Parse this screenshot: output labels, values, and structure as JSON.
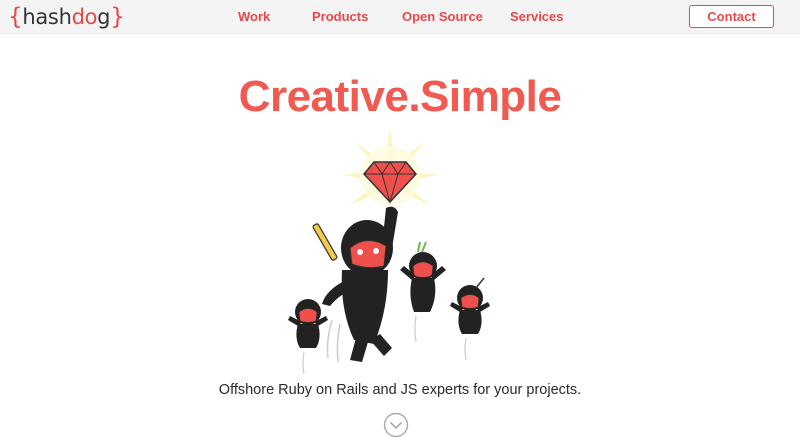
{
  "logo": {
    "open_brace": "{",
    "part1": "hash",
    "part2": "d",
    "part3": "o",
    "part4": "g",
    "close_brace": "}"
  },
  "nav": {
    "work": "Work",
    "products": "Products",
    "open_source": "Open Source",
    "services": "Services",
    "contact": "Contact"
  },
  "hero": {
    "title": "Creative.Simple",
    "tagline": "Offshore Ruby on Rails and JS experts for your projects."
  },
  "icons": {
    "scroll": "chevron-down-circle-icon",
    "illustration": "ninja-ruby-illustration"
  },
  "colors": {
    "accent": "#e8484a",
    "title": "#f05a50",
    "nav_bg": "#f4f4f4"
  }
}
